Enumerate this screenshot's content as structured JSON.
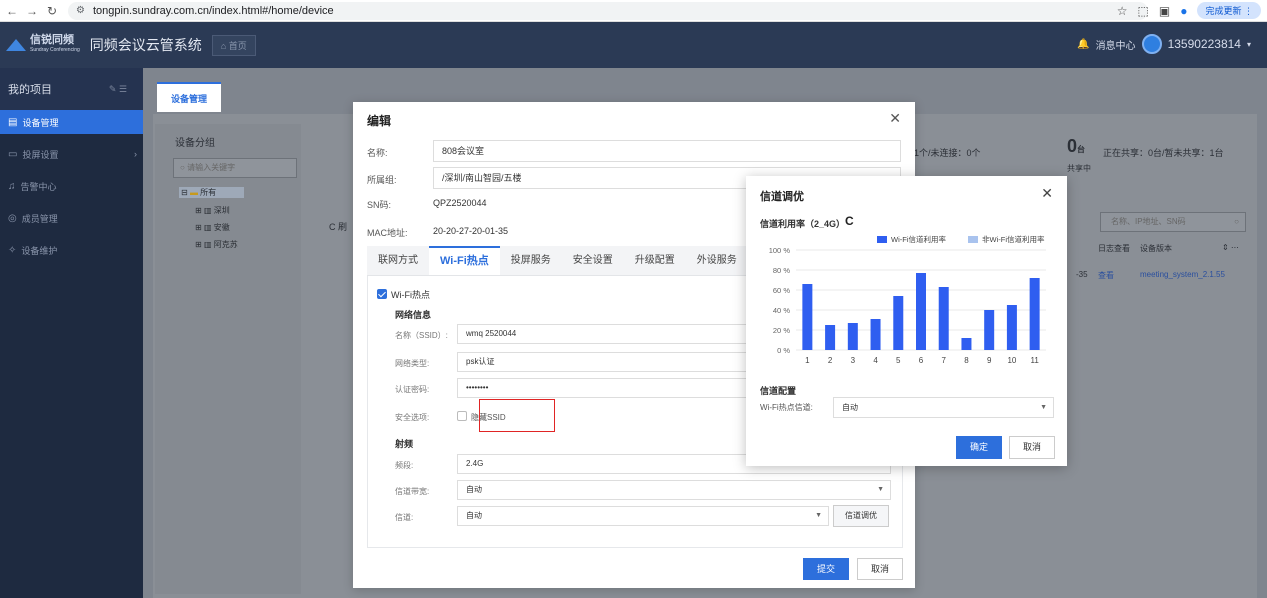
{
  "browser": {
    "url": "tongpin.sundray.com.cn/index.html#/home/device",
    "update_label": "完成更新"
  },
  "header": {
    "brand": "信锐同频",
    "brand_sub": "Sundray Conferencing",
    "system_title": "同频会议云管系统",
    "home_tab": "首页",
    "message_center": "消息中心",
    "phone": "13590223814"
  },
  "sidebar": {
    "title": "我的项目",
    "items": [
      {
        "label": "设备管理",
        "icon": "device-icon"
      },
      {
        "label": "投屏设置",
        "icon": "cast-icon"
      },
      {
        "label": "告警中心",
        "icon": "bell-icon"
      },
      {
        "label": "成员管理",
        "icon": "member-icon"
      },
      {
        "label": "设备维护",
        "icon": "wrench-icon"
      }
    ]
  },
  "main": {
    "tab": "设备管理",
    "group_title": "设备分组",
    "group_search_placeholder": "请输入关键字",
    "tree": [
      "所有",
      "深圳",
      "安徽",
      "阿克苏"
    ],
    "stats_text": "1个/未连接：0个",
    "share_count": "0",
    "share_unit": "台",
    "share_text": "正在共享：0台/暂未共享：1台",
    "share_label": "共享中",
    "refresh_label": "刷",
    "search_placeholder": "名称、IP地址、SN码",
    "col_log": "日志查看",
    "col_version": "设备版本",
    "row_ip_tail": "-35",
    "row_view": "查看",
    "row_version": "meeting_system_2.1.55"
  },
  "edit_dialog": {
    "title": "编辑",
    "name_label": "名称:",
    "name_value": "808会议室",
    "group_label": "所属组:",
    "group_value": "/深圳/南山智园/五楼",
    "sn_label": "SN码:",
    "sn_value": "QPZ2520044",
    "mac_label": "MAC地址:",
    "mac_value": "20-20-27-20-01-35",
    "tabs": [
      "联网方式",
      "Wi-Fi热点",
      "投屏服务",
      "安全设置",
      "升级配置",
      "外设服务"
    ],
    "wifi_hotspot_label": "Wi-Fi热点",
    "network_info_title": "网络信息",
    "ssid_label": "名称（SSID）:",
    "ssid_value": "wmq 2520044",
    "net_type_label": "网络类型:",
    "net_type_value": "psk认证",
    "password_label": "认证密码:",
    "password_value": "••••••••",
    "security_label": "安全选项:",
    "hide_ssid_label": "隐藏SSID",
    "rf_title": "射频",
    "band_label": "频段:",
    "band_value": "2.4G",
    "bandwidth_label": "信道带宽:",
    "bandwidth_value": "自动",
    "channel_label": "信道:",
    "channel_value": "自动",
    "optimize_button": "信道调优",
    "submit": "提交",
    "cancel": "取消"
  },
  "channel_modal": {
    "title": "信道调优",
    "util_title": "信道利用率（2_4G）",
    "legend_wifi": "Wi-Fi信道利用率",
    "legend_non_wifi": "非Wi-Fi信道利用率",
    "config_title": "信道配置",
    "hotspot_channel_label": "Wi-Fi热点信道:",
    "hotspot_channel_value": "自动",
    "confirm": "确定",
    "cancel": "取消",
    "colors": {
      "wifi": "#2f5ef0",
      "non_wifi": "#a9c3ee"
    }
  },
  "chart_data": {
    "type": "bar",
    "categories": [
      "1",
      "2",
      "3",
      "4",
      "5",
      "6",
      "7",
      "8",
      "9",
      "10",
      "11"
    ],
    "series": [
      {
        "name": "Wi-Fi信道利用率",
        "values": [
          66,
          25,
          27,
          31,
          54,
          77,
          63,
          12,
          40,
          45,
          72
        ]
      },
      {
        "name": "非Wi-Fi信道利用率",
        "values": [
          0,
          0,
          0,
          0,
          0,
          0,
          0,
          0,
          0,
          0,
          0
        ]
      }
    ],
    "yticks": [
      "0 %",
      "20 %",
      "40 %",
      "60 %",
      "80 %",
      "100 %"
    ],
    "ylim": [
      0,
      100
    ],
    "grid": true,
    "legend": "top-right"
  }
}
